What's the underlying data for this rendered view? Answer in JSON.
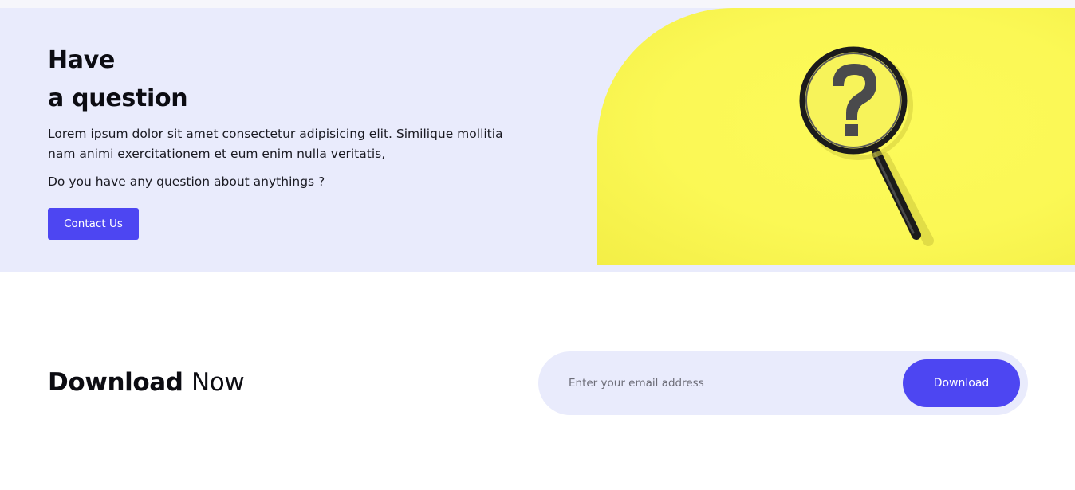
{
  "question": {
    "title_line1": "Have",
    "title_line2": "a question",
    "description": "Lorem ipsum dolor sit amet consectetur adipisicing elit. Similique mollitia nam animi exercitationem et eum enim nulla veritatis,",
    "ask": "Do you have any question about anythings ?",
    "contact_label": "Contact Us",
    "image_icon": "magnifying-glass-question-icon"
  },
  "download": {
    "title_bold": "Download",
    "title_light": "Now",
    "email_placeholder": "Enter your email address",
    "email_value": "",
    "button_label": "Download"
  },
  "colors": {
    "accent": "#4d46f2",
    "section_bg": "#e9ebfc",
    "image_bg": "#fbf855"
  }
}
